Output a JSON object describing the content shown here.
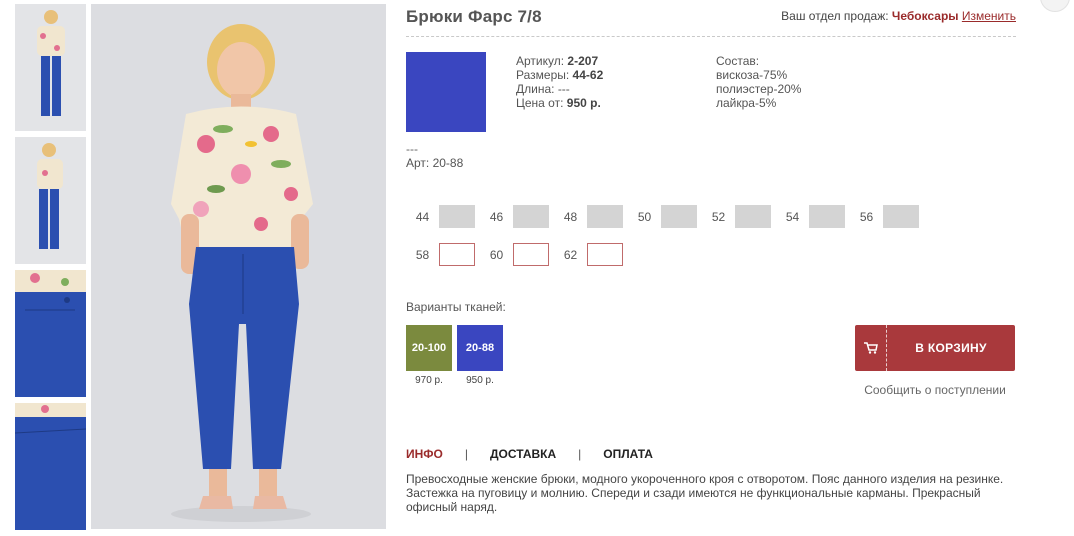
{
  "product": {
    "title": "Брюки Фарс 7/8",
    "main_color": "#3a46c0"
  },
  "sales_dept": {
    "label": "Ваш отдел продаж:",
    "city": "Чебоксары",
    "change_link": "Изменить"
  },
  "specs": {
    "article_label": "Артикул:",
    "article_value": "2-207",
    "sizes_label": "Размеры:",
    "sizes_value": "44-62",
    "length_label": "Длина:",
    "length_value": "---",
    "price_label": "Цена от:",
    "price_value": "950 р."
  },
  "composition": {
    "label": "Состав:",
    "items": [
      "вискоза-75%",
      "полиэстер-20%",
      "лайкра-5%"
    ]
  },
  "swatch_info": {
    "dashes": "---",
    "art": "Арт: 20-88"
  },
  "sizes": {
    "row1": [
      {
        "num": "44",
        "available": false
      },
      {
        "num": "46",
        "available": false
      },
      {
        "num": "48",
        "available": false
      },
      {
        "num": "50",
        "available": false
      },
      {
        "num": "52",
        "available": false
      },
      {
        "num": "54",
        "available": false
      },
      {
        "num": "56",
        "available": false
      }
    ],
    "row2": [
      {
        "num": "58",
        "available": true
      },
      {
        "num": "60",
        "available": true
      },
      {
        "num": "62",
        "available": true
      }
    ]
  },
  "fabrics": {
    "label": "Варианты тканей:",
    "items": [
      {
        "code": "20-100",
        "price": "970 р.",
        "color": "#7b8a3e"
      },
      {
        "code": "20-88",
        "price": "950 р.",
        "color": "#3a46c0"
      }
    ]
  },
  "cart": {
    "button_label": "В КОРЗИНУ",
    "button_color": "#a9393c",
    "notify_label": "Сообщить о поступлении"
  },
  "tabs": {
    "items": [
      "ИНФО",
      "ДОСТАВКА",
      "ОПЛАТА"
    ],
    "separator": "|",
    "active": "ИНФО"
  },
  "description": "Превосходные женские брюки, модного укороченного кроя с отворотом. Пояс данного изделия на резинке. Застежка на пуговицу и молнию. Спереди и сзади имеются не функциональные карманы. Прекрасный офисный наряд.",
  "colors": {
    "accent": "#9a2b2b",
    "trousers_blue": "#2b4fb0"
  }
}
